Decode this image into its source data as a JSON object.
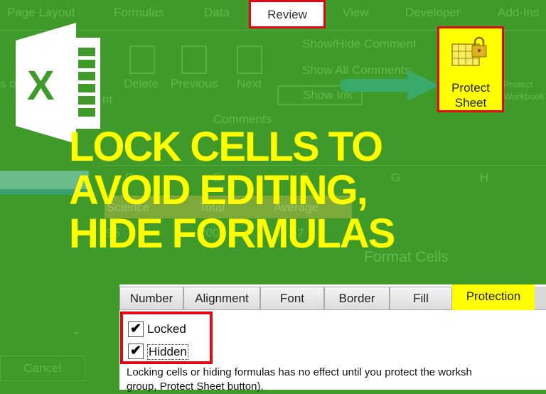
{
  "ribbon_tabs": [
    "Page Layout",
    "Formulas",
    "Data",
    "Review",
    "View",
    "Developer",
    "Add-Ins"
  ],
  "ribbon": {
    "buttons": [
      "Delete",
      "Previous",
      "Next"
    ],
    "comment_actions": [
      "Show/Hide Comment",
      "Show All Comments",
      "Show Ink"
    ],
    "group_label": "Comments",
    "protect_sheet": "Protect Sheet",
    "protect_workbook": "Protect Workbook",
    "left_fragment": "nt",
    "left_fragment2": "s of Cells"
  },
  "headline": [
    "LOCK CELLS TO",
    "AVOID EDITING,",
    "HIDE FORMULAS"
  ],
  "sheet": {
    "columns": [
      "D",
      "E",
      "F",
      "G",
      "H"
    ],
    "headers": [
      "Science",
      "Total",
      "Average"
    ],
    "values": [
      "95",
      "200",
      "66.67"
    ]
  },
  "left_panel": {
    "cancel": "Cancel"
  },
  "dialog": {
    "title": "Format Cells",
    "tabs": [
      "Number",
      "Alignment",
      "Font",
      "Border",
      "Fill",
      "Protection"
    ],
    "active_tab": "Protection",
    "locked_label": "Locked",
    "hidden_label": "Hidden",
    "locked": true,
    "hidden": true,
    "check_glyph": "✔",
    "note_line1": "Locking cells or hiding formulas has no effect until you protect the worksh",
    "note_line2": "group, Protect Sheet button)."
  },
  "colors": {
    "background": "#3f9a2a",
    "headline": "#ffff00",
    "highlight": "#e30613",
    "arrow": "#3aaa6a"
  }
}
